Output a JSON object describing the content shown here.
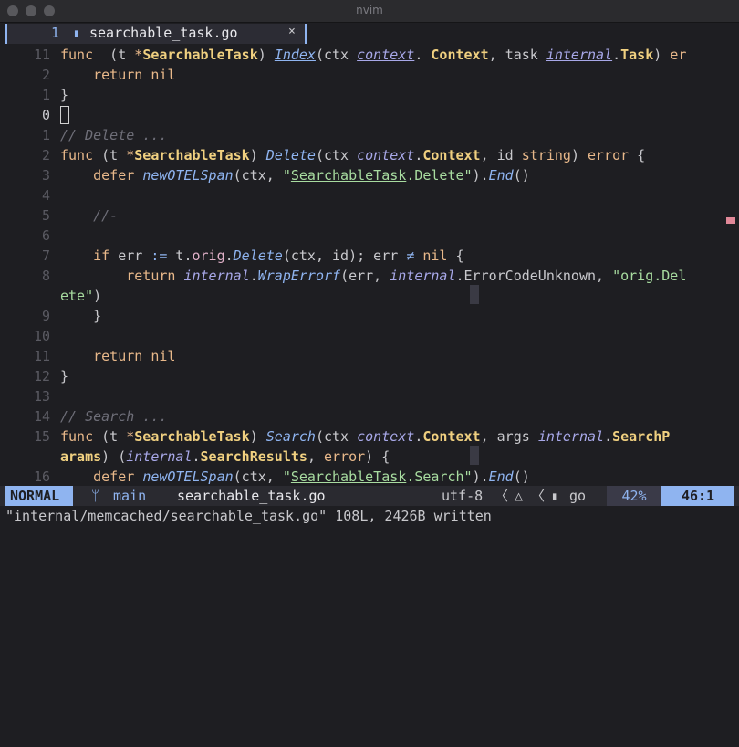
{
  "window": {
    "title": "nvim"
  },
  "tab": {
    "number": "1",
    "icon": "go-file-icon",
    "name": "searchable_task.go",
    "close": "×"
  },
  "lines": [
    {
      "n": "11",
      "cur": false,
      "t": [
        [
          "kw",
          "func"
        ],
        [
          "",
          "  ("
        ],
        [
          "",
          "t "
        ],
        [
          "kw",
          "*"
        ],
        [
          "ty",
          "SearchableTask"
        ],
        [
          "",
          ") "
        ],
        [
          "fn ul",
          "Index"
        ],
        [
          "",
          "("
        ],
        [
          "",
          "ctx "
        ],
        [
          "pk ul",
          "context"
        ],
        [
          "",
          ". "
        ],
        [
          "ty",
          "Context"
        ],
        [
          "",
          ", "
        ],
        [
          "",
          "task "
        ],
        [
          "pk ul",
          "internal"
        ],
        [
          "",
          "."
        ],
        [
          "ty",
          "Task"
        ],
        [
          "",
          ") "
        ],
        [
          "kw",
          "er"
        ]
      ]
    },
    {
      "n": "2",
      "cur": false,
      "t": [
        [
          "",
          "    "
        ],
        [
          "kw",
          "return"
        ],
        [
          "",
          " "
        ],
        [
          "kw",
          "nil"
        ]
      ]
    },
    {
      "n": "1",
      "cur": false,
      "t": [
        [
          "",
          "}"
        ]
      ]
    },
    {
      "n": "0",
      "cur": true,
      "t": [
        [
          "cursor",
          ""
        ]
      ]
    },
    {
      "n": "1",
      "cur": false,
      "t": [
        [
          "cm",
          "// Delete ..."
        ]
      ]
    },
    {
      "n": "2",
      "cur": false,
      "t": [
        [
          "kw",
          "func"
        ],
        [
          "",
          " (t "
        ],
        [
          "kw",
          "*"
        ],
        [
          "ty",
          "SearchableTask"
        ],
        [
          "",
          ") "
        ],
        [
          "fn",
          "Delete"
        ],
        [
          "",
          "(ctx "
        ],
        [
          "pk",
          "context"
        ],
        [
          "",
          "."
        ],
        [
          "ty",
          "Context"
        ],
        [
          "",
          ", id "
        ],
        [
          "kw",
          "string"
        ],
        [
          "",
          ") "
        ],
        [
          "kw",
          "error"
        ],
        [
          "",
          " {"
        ]
      ]
    },
    {
      "n": "3",
      "cur": false,
      "t": [
        [
          "",
          "    "
        ],
        [
          "kw",
          "defer"
        ],
        [
          "",
          " "
        ],
        [
          "fn",
          "newOTELSpan"
        ],
        [
          "",
          "(ctx, "
        ],
        [
          "str",
          "\""
        ],
        [
          "str ul",
          "SearchableTask"
        ],
        [
          "str",
          ".Delete\""
        ],
        [
          "",
          ")."
        ],
        [
          "fn",
          "End"
        ],
        [
          "",
          "()"
        ]
      ]
    },
    {
      "n": "4",
      "cur": false,
      "t": []
    },
    {
      "n": "5",
      "cur": false,
      "t": [
        [
          "",
          "    "
        ],
        [
          "cm",
          "//-"
        ]
      ]
    },
    {
      "n": "6",
      "cur": false,
      "t": []
    },
    {
      "n": "7",
      "cur": false,
      "t": [
        [
          "",
          "    "
        ],
        [
          "kw",
          "if"
        ],
        [
          "",
          " err "
        ],
        [
          "op",
          ":="
        ],
        [
          "",
          " t."
        ],
        [
          "pr",
          "orig"
        ],
        [
          "",
          "."
        ],
        [
          "fn",
          "Delete"
        ],
        [
          "",
          "(ctx, id); err "
        ],
        [
          "op",
          "≠"
        ],
        [
          "",
          " "
        ],
        [
          "kw",
          "nil"
        ],
        [
          "",
          " {"
        ]
      ]
    },
    {
      "n": "8",
      "cur": false,
      "t": [
        [
          "",
          "        "
        ],
        [
          "kw",
          "return"
        ],
        [
          "",
          " "
        ],
        [
          "pk",
          "internal"
        ],
        [
          "",
          "."
        ],
        [
          "fn",
          "WrapErrorf"
        ],
        [
          "",
          "(err, "
        ],
        [
          "pk",
          "internal"
        ],
        [
          "",
          ".ErrorCodeUnknown, "
        ],
        [
          "str",
          "\"orig.Del"
        ]
      ]
    },
    {
      "n": "",
      "cur": false,
      "t": [
        [
          "str",
          "ete\""
        ],
        [
          "",
          ")"
        ]
      ]
    },
    {
      "n": "9",
      "cur": false,
      "t": [
        [
          "",
          "    }"
        ]
      ]
    },
    {
      "n": "10",
      "cur": false,
      "t": []
    },
    {
      "n": "11",
      "cur": false,
      "t": [
        [
          "",
          "    "
        ],
        [
          "kw",
          "return"
        ],
        [
          "",
          " "
        ],
        [
          "kw",
          "nil"
        ]
      ]
    },
    {
      "n": "12",
      "cur": false,
      "t": [
        [
          "",
          "}"
        ]
      ]
    },
    {
      "n": "13",
      "cur": false,
      "t": []
    },
    {
      "n": "14",
      "cur": false,
      "t": [
        [
          "cm",
          "// Search ..."
        ]
      ]
    },
    {
      "n": "15",
      "cur": false,
      "t": [
        [
          "kw",
          "func"
        ],
        [
          "",
          " (t "
        ],
        [
          "kw",
          "*"
        ],
        [
          "ty",
          "SearchableTask"
        ],
        [
          "",
          ") "
        ],
        [
          "fn",
          "Search"
        ],
        [
          "",
          "(ctx "
        ],
        [
          "pk",
          "context"
        ],
        [
          "",
          "."
        ],
        [
          "ty",
          "Context"
        ],
        [
          "",
          ", args "
        ],
        [
          "pk",
          "internal"
        ],
        [
          "",
          "."
        ],
        [
          "ty",
          "SearchP"
        ]
      ]
    },
    {
      "n": "",
      "cur": false,
      "t": [
        [
          "ty",
          "arams"
        ],
        [
          "",
          ") ("
        ],
        [
          "pk",
          "internal"
        ],
        [
          "",
          "."
        ],
        [
          "ty",
          "SearchResults"
        ],
        [
          "",
          ", "
        ],
        [
          "kw",
          "error"
        ],
        [
          "",
          ") {"
        ]
      ]
    },
    {
      "n": "16",
      "cur": false,
      "t": [
        [
          "",
          "    "
        ],
        [
          "kw",
          "defer"
        ],
        [
          "",
          " "
        ],
        [
          "fn",
          "newOTELSpan"
        ],
        [
          "",
          "(ctx, "
        ],
        [
          "str",
          "\""
        ],
        [
          "str ul",
          "SearchableTask"
        ],
        [
          "str",
          ".Search\""
        ],
        [
          "",
          ")."
        ],
        [
          "fn",
          "End"
        ],
        [
          "",
          "()"
        ]
      ]
    }
  ],
  "status": {
    "mode": "NORMAL",
    "branch_icon": "git-branch-icon",
    "branch": "main",
    "file": "searchable_task.go",
    "encoding": "utf-8",
    "sep1": "〈",
    "os_icon": "linux-icon",
    "sep2": "〈",
    "ft_icon": "go-file-icon",
    "filetype": "go",
    "percent": "42%",
    "position": "46:1"
  },
  "cmdline": "\"internal/memcached/searchable_task.go\" 108L, 2426B written"
}
